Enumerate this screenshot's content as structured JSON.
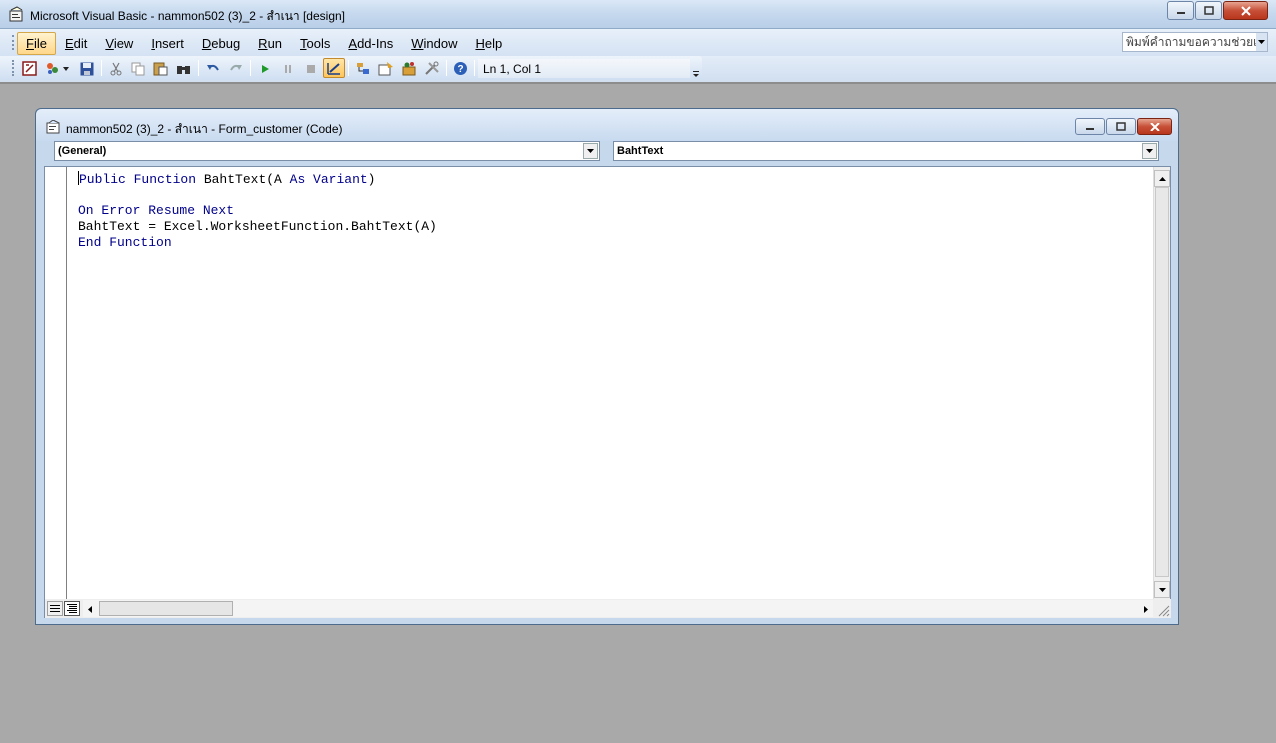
{
  "window": {
    "title": "Microsoft Visual Basic - nammon502 (3)_2 - สำเนา [design]",
    "app_icon": "vba-editor-icon"
  },
  "menubar": {
    "items": [
      {
        "label": "File",
        "underline": "F"
      },
      {
        "label": "Edit",
        "underline": "E"
      },
      {
        "label": "View",
        "underline": "V"
      },
      {
        "label": "Insert",
        "underline": "I"
      },
      {
        "label": "Debug",
        "underline": "D"
      },
      {
        "label": "Run",
        "underline": "R"
      },
      {
        "label": "Tools",
        "underline": "T"
      },
      {
        "label": "Add-Ins",
        "underline": "A"
      },
      {
        "label": "Window",
        "underline": "W"
      },
      {
        "label": "Help",
        "underline": "H"
      }
    ],
    "help_box_placeholder": "พิมพ์คำถามขอความช่วยเหลือ"
  },
  "toolbar": {
    "position_text": "Ln 1, Col 1",
    "icons": [
      "view-excel-icon",
      "insert-userform-icon",
      "save-icon",
      "cut-icon",
      "copy-icon",
      "paste-icon",
      "find-icon",
      "undo-icon",
      "redo-icon",
      "run-icon",
      "break-icon",
      "reset-icon",
      "design-mode-icon",
      "project-explorer-icon",
      "properties-window-icon",
      "object-browser-icon",
      "toolbox-icon",
      "help-icon"
    ]
  },
  "code_window": {
    "title": "nammon502 (3)_2 - สำเนา - Form_customer (Code)",
    "object_combo": "(General)",
    "procedure_combo": "BahtText",
    "lines": [
      [
        {
          "t": "Public Function",
          "k": true
        },
        {
          "t": " BahtText(A ",
          "k": false
        },
        {
          "t": "As Variant",
          "k": true
        },
        {
          "t": ")",
          "k": false
        }
      ],
      [],
      [
        {
          "t": "On Error Resume Next",
          "k": true
        }
      ],
      [
        {
          "t": "BahtText = Excel.WorksheetFunction.BahtText(A)",
          "k": false
        }
      ],
      [
        {
          "t": "End Function",
          "k": true
        }
      ]
    ]
  },
  "colors": {
    "keyword": "#00008b",
    "mdi_background": "#a9a9a9"
  }
}
